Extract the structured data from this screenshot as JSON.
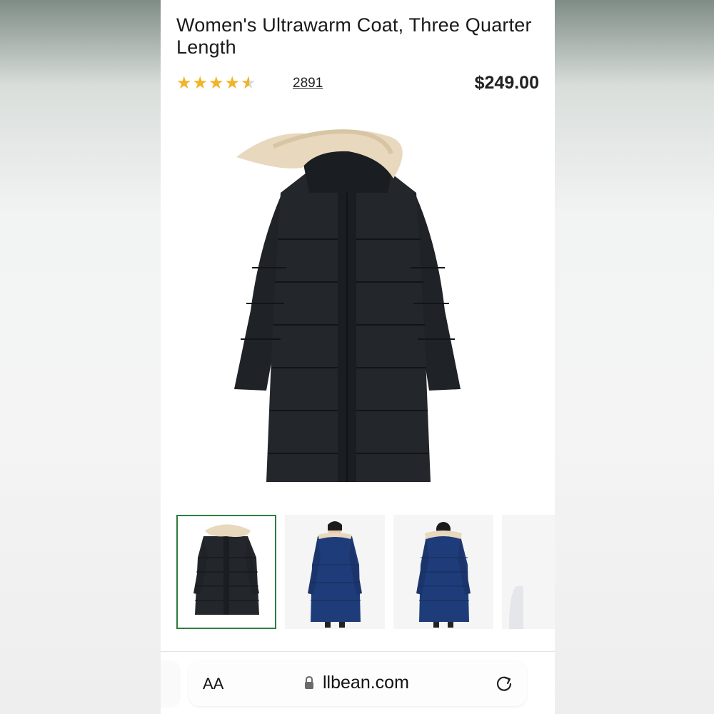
{
  "product": {
    "title": "Women's Ultrawarm Coat, Three Quarter Length",
    "rating_stars": "★★★★",
    "rating_value": 4.5,
    "review_count": "2891",
    "price": "$249.00"
  },
  "gallery": {
    "thumbnails": [
      {
        "label": "black coat front",
        "selected": true
      },
      {
        "label": "blue coat model front",
        "selected": false
      },
      {
        "label": "blue coat model back",
        "selected": false
      },
      {
        "label": "partial thumbnail",
        "selected": false
      }
    ]
  },
  "browser": {
    "text_size_label": "AA",
    "url": "llbean.com",
    "icons": [
      "lock-icon",
      "reload-icon"
    ]
  },
  "colors": {
    "star": "#f0b429",
    "selected_outline": "#2f7d3b",
    "coat_black": "#1f2328",
    "coat_navy": "#1f3c7a",
    "fur": "#e8d8bd"
  }
}
